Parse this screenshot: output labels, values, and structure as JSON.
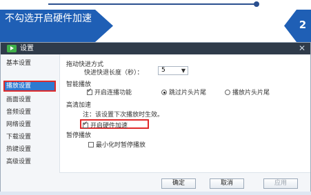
{
  "banner": {
    "title": "不勾选开启硬件加速",
    "step": "2"
  },
  "dialog": {
    "title": "设置"
  },
  "sidebar": {
    "items": [
      {
        "label": "基本设置"
      },
      {
        "label": "播放设置"
      },
      {
        "label": "画面设置"
      },
      {
        "label": "音频设置"
      },
      {
        "label": "网络设置"
      },
      {
        "label": "下载设置"
      },
      {
        "label": "热键设置"
      },
      {
        "label": "高级设置"
      }
    ],
    "active_index": 1
  },
  "main": {
    "fast_seek": {
      "heading": "拖动快进方式",
      "label": "快进快退长度（秒）：",
      "value": "5"
    },
    "smart_play": {
      "heading": "智能播放",
      "continue": {
        "label": "开启连播功能",
        "checked": true
      },
      "skip_intro": {
        "label": "跳过片头片尾",
        "selected": true
      },
      "play_intro": {
        "label": "播放片头片尾",
        "selected": false
      }
    },
    "hd_accel": {
      "heading": "高清加速",
      "note": "注：该设置下次播放时生效。",
      "hw_accel": {
        "label": "开启硬件加速",
        "checked": true
      }
    },
    "pause": {
      "heading": "暂停播放",
      "minimize_pause": {
        "label": "最小化时暂停播放",
        "checked": false
      }
    }
  },
  "footer": {
    "ok": "确定",
    "cancel": "取消",
    "apply": "应用"
  },
  "colors": {
    "banner": "#1f5fb5",
    "active": "#2e7ad1",
    "highlight": "#e02a2a"
  }
}
